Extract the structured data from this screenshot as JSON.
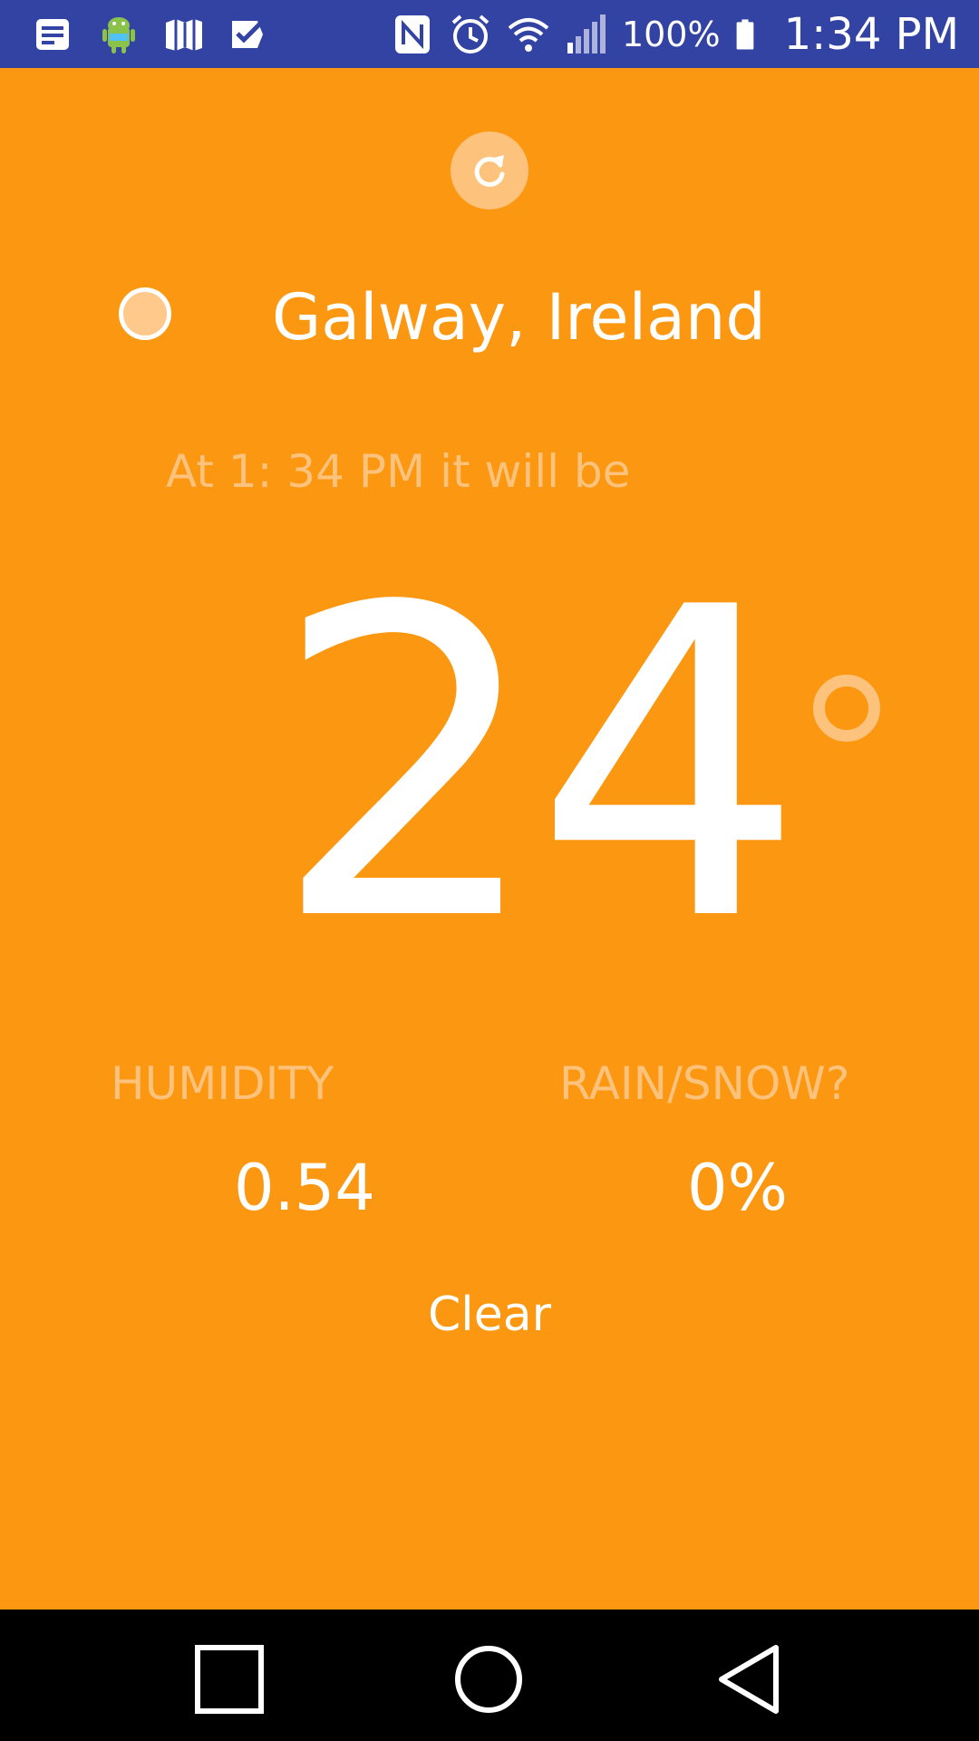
{
  "status_bar": {
    "battery_text": "100%",
    "time": "1:34 PM",
    "icons_left": [
      "notes-icon",
      "android-icon",
      "maps-icon",
      "check-icon"
    ],
    "icons_right": [
      "nfc-icon",
      "alarm-icon",
      "wifi-icon",
      "signal-icon",
      "battery-icon"
    ]
  },
  "weather": {
    "location": "Galway, Ireland",
    "time_text": "At 1: 34 PM it will be",
    "temperature": "24",
    "humidity_label": "HUMIDITY",
    "humidity_value": "0.54",
    "precip_label": "RAIN/SNOW?",
    "precip_value": "0%",
    "summary": "Clear"
  },
  "nav_bar": {
    "buttons": [
      "recents-icon",
      "home-icon",
      "back-icon"
    ]
  },
  "colors": {
    "background": "#fb9710",
    "status_bar": "#3343a3",
    "accent_light": "#fdc27b",
    "text": "#ffffff"
  }
}
